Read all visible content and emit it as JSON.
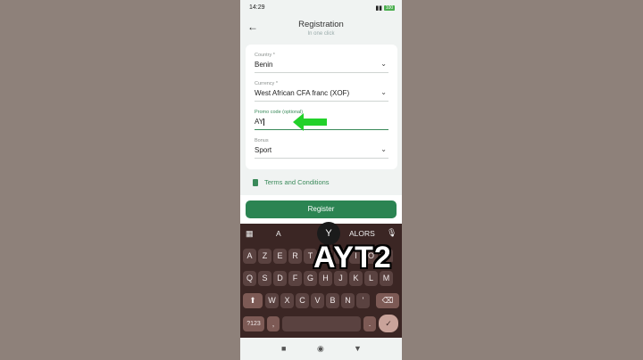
{
  "status": {
    "time": "14:29",
    "battery": "100"
  },
  "header": {
    "title": "Registration",
    "subtitle": "In one click"
  },
  "form": {
    "country": {
      "label": "Country *",
      "value": "Benin"
    },
    "currency": {
      "label": "Currency *",
      "value": "West African CFA franc (XOF)"
    },
    "promo": {
      "label": "Promo code (optional)",
      "value": "AY"
    },
    "bonus": {
      "label": "Bonus",
      "value": "Sport"
    }
  },
  "terms": {
    "label": "Terms and Conditions"
  },
  "register": {
    "label": "Register"
  },
  "keyboard": {
    "suggestions": [
      "A",
      "Y",
      "ALORS"
    ],
    "row1": [
      "A",
      "Z",
      "E",
      "R",
      "T",
      "Y",
      "U",
      "I",
      "O",
      "P"
    ],
    "row2": [
      "Q",
      "S",
      "D",
      "F",
      "G",
      "H",
      "J",
      "K",
      "L",
      "M"
    ],
    "row3": [
      "W",
      "X",
      "C",
      "V",
      "B",
      "N",
      "'"
    ],
    "sym": "?123",
    "comma": ",",
    "period": "."
  },
  "overlay_text": "AYT2",
  "colors": {
    "accent": "#2b8452",
    "keyboard_bg": "#3b2624",
    "arrow": "#22d12a"
  }
}
